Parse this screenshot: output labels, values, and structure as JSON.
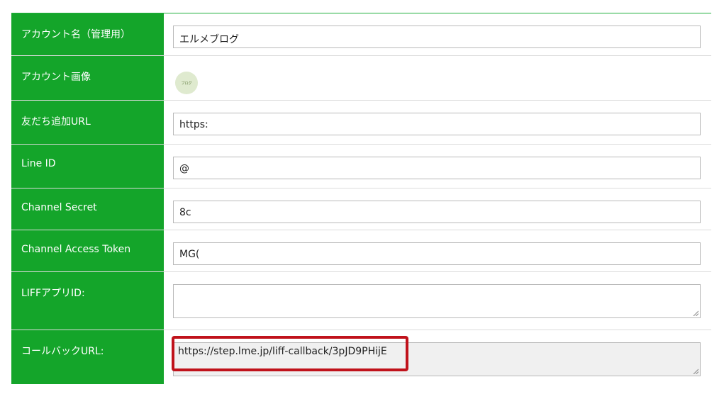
{
  "fields": [
    {
      "label": "アカウント名（管理用）",
      "type": "input",
      "value": "エルメブログ"
    },
    {
      "label": "アカウント画像",
      "type": "image",
      "value": "ブログ"
    },
    {
      "label": "友だち追加URL",
      "type": "input",
      "value": "https:"
    },
    {
      "label": "Line ID",
      "type": "input",
      "value": "@"
    },
    {
      "label": "Channel Secret",
      "type": "input",
      "value": "8c"
    },
    {
      "label": "Channel Access Token",
      "type": "input",
      "value": "MG("
    },
    {
      "label": "LIFFアプリID:",
      "type": "textarea",
      "value": ""
    },
    {
      "label": "コールバックURL:",
      "type": "textarea-readonly",
      "value": "https://step.lme.jp/liff-callback/3pJD9PHijE"
    }
  ],
  "colors": {
    "label_bg": "#14a52a",
    "highlight": "#c0121b"
  }
}
